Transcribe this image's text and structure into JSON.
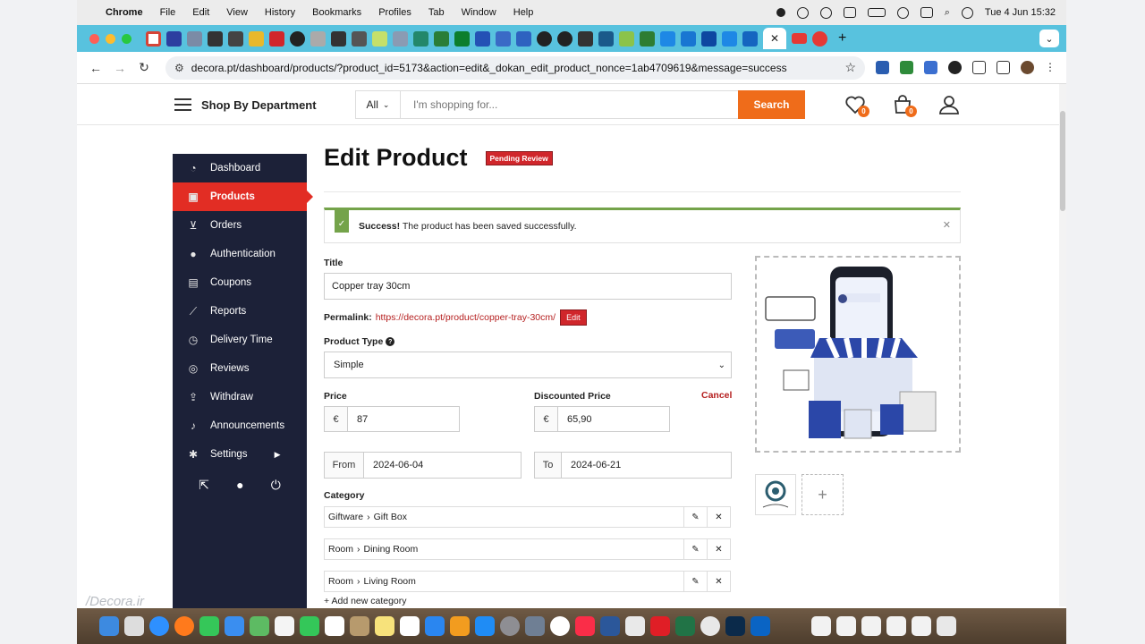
{
  "menubar": {
    "app": "Chrome",
    "items": [
      "File",
      "Edit",
      "View",
      "History",
      "Bookmarks",
      "Profiles",
      "Tab",
      "Window",
      "Help"
    ],
    "datetime": "Tue 4 Jun  15:32"
  },
  "browser": {
    "url": "decora.pt/dashboard/products/?product_id=5173&action=edit&_dokan_edit_product_nonce=1ab4709619&message=success"
  },
  "header": {
    "shop_by_department": "Shop By Department",
    "category_selected": "All",
    "search_placeholder": "I'm shopping for...",
    "search_button": "Search",
    "wishlist_count": "0",
    "cart_count": "0"
  },
  "sidebar": {
    "items": [
      {
        "label": "Dashboard",
        "icon": "speedometer-icon"
      },
      {
        "label": "Products",
        "icon": "briefcase-icon"
      },
      {
        "label": "Orders",
        "icon": "cart-icon"
      },
      {
        "label": "Authentication",
        "icon": "user-icon"
      },
      {
        "label": "Coupons",
        "icon": "gift-icon"
      },
      {
        "label": "Reports",
        "icon": "line-chart-icon"
      },
      {
        "label": "Delivery Time",
        "icon": "clock-icon"
      },
      {
        "label": "Reviews",
        "icon": "comments-icon"
      },
      {
        "label": "Withdraw",
        "icon": "upload-icon"
      },
      {
        "label": "Announcements",
        "icon": "bell-icon"
      },
      {
        "label": "Settings",
        "icon": "gear-icon"
      }
    ],
    "active": "Products"
  },
  "page": {
    "title": "Edit Product",
    "status_badge": "Pending Review",
    "alert_strong": "Success!",
    "alert_text": " The product has been saved successfully.",
    "title_label": "Title",
    "title_value": "Copper tray 30cm",
    "permalink_label": "Permalink:",
    "permalink_url": "https://decora.pt/product/copper-tray-30cm/",
    "permalink_edit": "Edit",
    "product_type_label": "Product Type",
    "product_type_value": "Simple",
    "price_label": "Price",
    "price_currency": "€",
    "price_value": "87",
    "discounted_label": "Discounted Price",
    "discounted_currency": "€",
    "discounted_value": "65,90",
    "cancel": "Cancel",
    "from_label": "From",
    "from_value": "2024-06-04",
    "to_label": "To",
    "to_value": "2024-06-21",
    "category_label": "Category",
    "categories": [
      {
        "parent": "Giftware",
        "child": "Gift Box"
      },
      {
        "parent": "Room",
        "child": "Dining Room"
      },
      {
        "parent": "Room",
        "child": "Living Room"
      }
    ],
    "add_category": "+ Add new category"
  },
  "watermark": "/Decora.ir",
  "colors": {
    "accent": "#e22d24",
    "sidebar_bg": "#1c2138",
    "search_btn": "#ef6c1a",
    "success": "#74a34a",
    "tabstrip": "#58c2de"
  }
}
